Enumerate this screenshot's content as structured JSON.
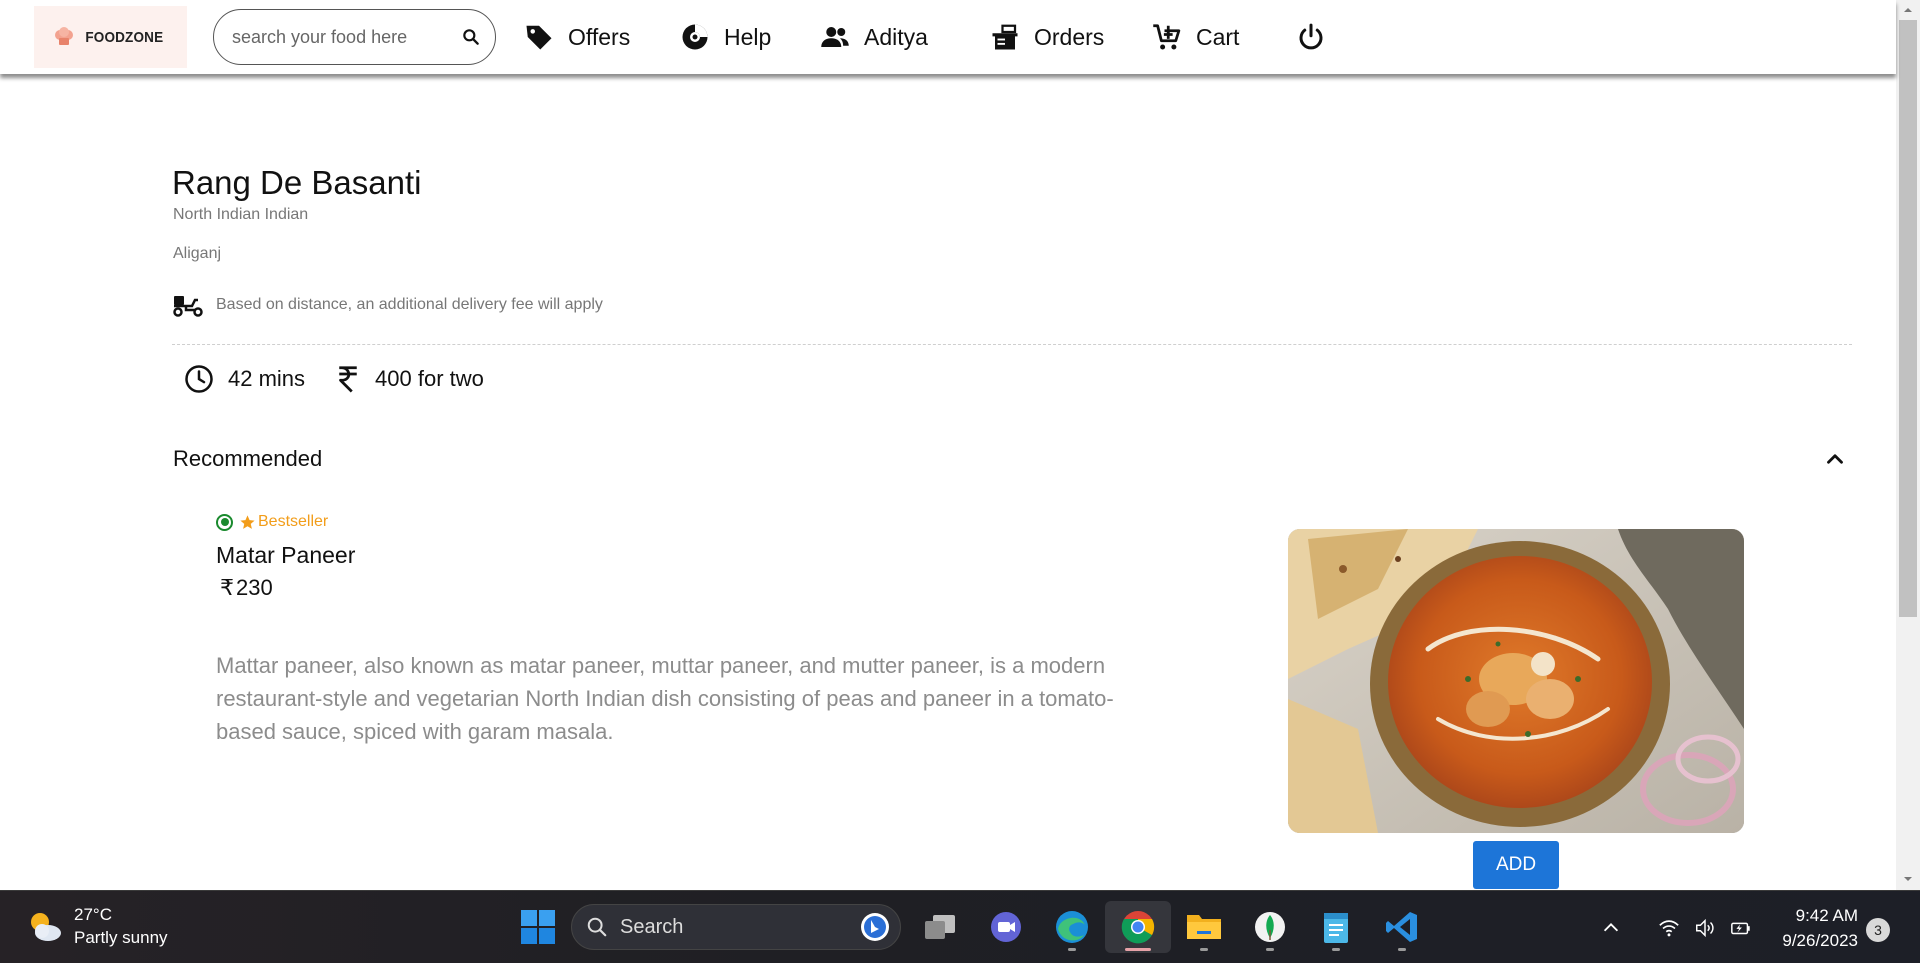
{
  "navbar": {
    "logo_text": "FOODZONE",
    "search_placeholder": "search your food here",
    "offers": "Offers",
    "help": "Help",
    "user": "Aditya",
    "orders": "Orders",
    "cart": "Cart"
  },
  "restaurant": {
    "name": "Rang De Basanti",
    "cuisine": "North Indian Indian",
    "area": "Aliganj",
    "delivery_note": "Based on distance, an additional delivery fee will apply",
    "time": "42 mins",
    "cost": "400 for two"
  },
  "menu": {
    "section_title": "Recommended",
    "item": {
      "badge": "Bestseller",
      "name": "Matar Paneer",
      "currency": "₹",
      "price": "230",
      "description": "Mattar paneer, also known as matar paneer, muttar paneer, and mutter paneer, is a modern restaurant-style and vegetarian North Indian dish consisting of peas and paneer in a tomato-based sauce, spiced with garam masala.",
      "add_label": "ADD"
    }
  },
  "taskbar": {
    "weather_temp": "27°C",
    "weather_desc": "Partly sunny",
    "search_label": "Search",
    "time": "9:42 AM",
    "date": "9/26/2023",
    "notifications": "3"
  },
  "colors": {
    "accent_button": "#1d75d8",
    "bestseller": "#f29d1a",
    "veg": "#1a8a2e"
  }
}
